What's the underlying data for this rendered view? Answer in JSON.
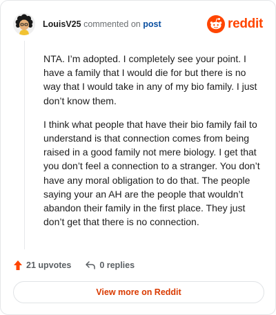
{
  "header": {
    "username": "LouisV25",
    "commented_on": "commented on",
    "post_link": "post",
    "brand": "reddit"
  },
  "comment": {
    "paragraphs": [
      "NTA. I’m adopted. I completely see your point. I have a family that I would die for but there is no way that I would take in any of my bio family. I just don’t know them.",
      "I think what people that have their bio family fail to understand is that connection comes from being raised in a good family not mere biology. I get that you don’t feel a connection to a stranger. You don’t have any moral obligation to do that. The people saying your an AH are the people that wouldn’t abandon their family in the first place. They just don’t get that there is no connection."
    ]
  },
  "actions": {
    "upvotes": "21 upvotes",
    "replies": "0 replies"
  },
  "cta": {
    "label": "View more on Reddit"
  },
  "colors": {
    "accent": "#ff4500",
    "link": "#0a4fa0",
    "cta_text": "#d93a00"
  },
  "icons": [
    "avatar",
    "reddit-logo-icon",
    "upvote-arrow-icon",
    "reply-icon"
  ]
}
